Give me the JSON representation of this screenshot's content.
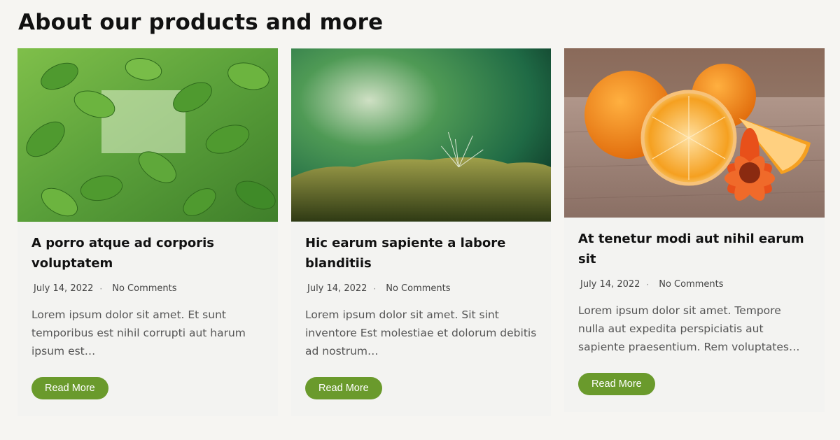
{
  "section": {
    "title": "About our products and more"
  },
  "posts": [
    {
      "title": "A porro atque ad corporis voluptatem",
      "date": "July 14, 2022",
      "separator": "·",
      "comments": "No Comments",
      "excerpt": "Lorem ipsum dolor sit amet. Et sunt temporibus est nihil corrupti aut harum ipsum est…",
      "button": "Read More",
      "image_subject": "green leaves"
    },
    {
      "title": "Hic earum sapiente a labore blanditiis",
      "date": "July 14, 2022",
      "separator": "·",
      "comments": "No Comments",
      "excerpt": "Lorem ipsum dolor sit amet. Sit sint inventore Est molestiae et dolorum debitis ad nostrum…",
      "button": "Read More",
      "image_subject": "moss with dandelion seed"
    },
    {
      "title": "At tenetur modi aut nihil earum sit",
      "date": "July 14, 2022",
      "separator": "·",
      "comments": "No Comments",
      "excerpt": "Lorem ipsum dolor sit amet. Tempore nulla aut expedita perspiciatis aut sapiente praesentium. Rem voluptates…",
      "button": "Read More",
      "image_subject": "oranges and gerbera flower"
    }
  ],
  "colors": {
    "button": "#6a9a2c",
    "background": "#f6f5f2"
  }
}
